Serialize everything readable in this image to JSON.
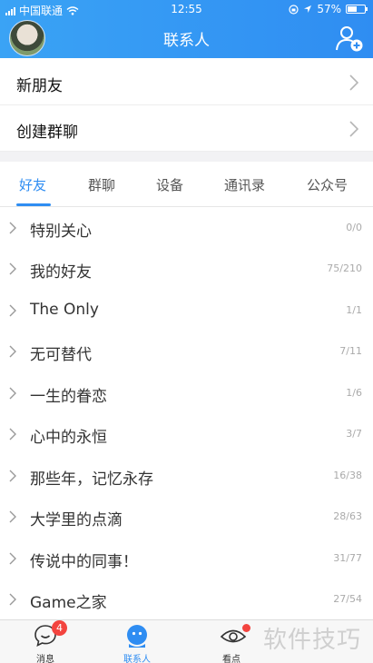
{
  "status_bar": {
    "carrier": "中国联通",
    "time": "12:55",
    "battery": "57%",
    "battery_level": 0.57
  },
  "header": {
    "title": "联系人"
  },
  "rows": [
    {
      "label": "新朋友"
    },
    {
      "label": "创建群聊"
    }
  ],
  "tabs": [
    {
      "label": "好友",
      "active": true
    },
    {
      "label": "群聊"
    },
    {
      "label": "设备"
    },
    {
      "label": "通讯录"
    },
    {
      "label": "公众号"
    }
  ],
  "groups": [
    {
      "name": "特别关心",
      "count": "0/0"
    },
    {
      "name": "我的好友",
      "count": "75/210"
    },
    {
      "name": "The Only",
      "count": "1/1"
    },
    {
      "name": "无可替代",
      "count": "7/11"
    },
    {
      "name": "一生的眷恋",
      "count": "1/6"
    },
    {
      "name": "心中的永恒",
      "count": "3/7"
    },
    {
      "name": "那些年，记忆永存",
      "count": "16/38"
    },
    {
      "name": "大学里的点滴",
      "count": "28/63"
    },
    {
      "name": "传说中的同事！",
      "count": "31/77"
    },
    {
      "name": "Game之家",
      "count": "27/54"
    }
  ],
  "bottom_nav": [
    {
      "label": "消息",
      "badge": "4",
      "icon": "chat-bubble-icon"
    },
    {
      "label": "联系人",
      "active": true,
      "icon": "contacts-person-icon"
    },
    {
      "label": "看点",
      "icon": "eye-icon"
    }
  ],
  "watermark": "软件技巧",
  "colors": {
    "accent": "#2f8df2",
    "badge": "#f3443f",
    "header_start": "#3aa3f5"
  }
}
